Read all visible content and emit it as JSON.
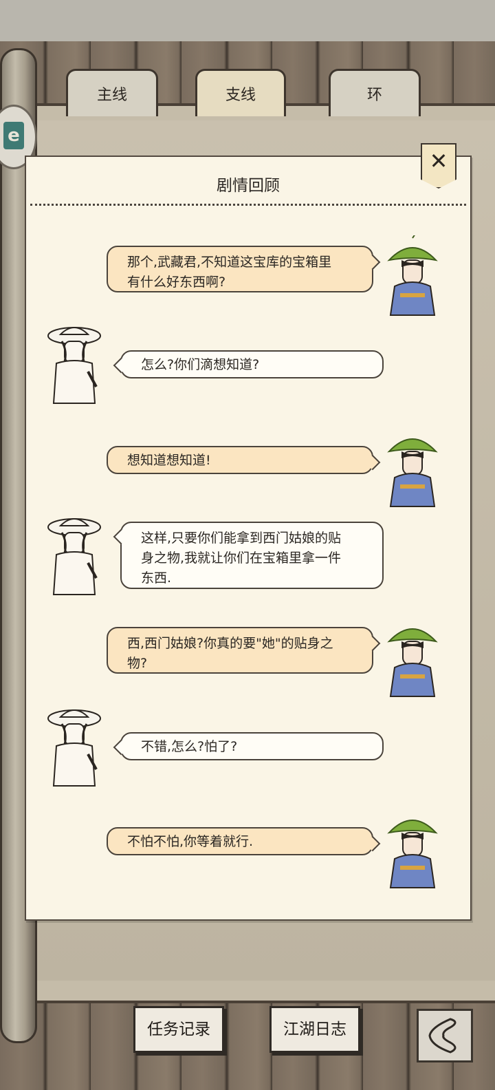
{
  "tabs": [
    {
      "label": "主线",
      "active": false
    },
    {
      "label": "支线",
      "active": true
    },
    {
      "label": "环",
      "active": false
    }
  ],
  "panel": {
    "title": "剧情回顾",
    "close_icon": "close-x-icon"
  },
  "dialogue": [
    {
      "speaker": "green-leaf-hat-boy",
      "side": "right",
      "text": [
        "那个,武藏君,不知道这宝库的宝箱里",
        "有什么好东西啊?"
      ]
    },
    {
      "speaker": "straw-hat-samurai",
      "side": "left",
      "text": [
        "怎么?你们滴想知道?"
      ]
    },
    {
      "speaker": "green-leaf-hat-boy",
      "side": "right",
      "text": [
        "想知道想知道!"
      ]
    },
    {
      "speaker": "straw-hat-samurai",
      "side": "left",
      "text": [
        "这样,只要你们能拿到西门姑娘的贴",
        "身之物,我就让你们在宝箱里拿一件",
        "东西."
      ]
    },
    {
      "speaker": "green-leaf-hat-boy",
      "side": "right",
      "text": [
        "西,西门姑娘?你真的要\"她\"的贴身之",
        "物?"
      ]
    },
    {
      "speaker": "straw-hat-samurai",
      "side": "left",
      "text": [
        "不错,怎么?怕了?"
      ]
    },
    {
      "speaker": "green-leaf-hat-boy",
      "side": "right",
      "text": [
        "不怕不怕,你等着就行."
      ]
    }
  ],
  "bottom": {
    "tasks_label": "任务记录",
    "journal_label": "江湖日志",
    "back_icon": "back-arrow-icon"
  },
  "colors": {
    "panel_bg": "#faf5e6",
    "bubble_right": "#fbe5c1",
    "bubble_left": "#fffdf6",
    "leaf_green": "#7fae3c",
    "robe_blue": "#6f86c4"
  }
}
